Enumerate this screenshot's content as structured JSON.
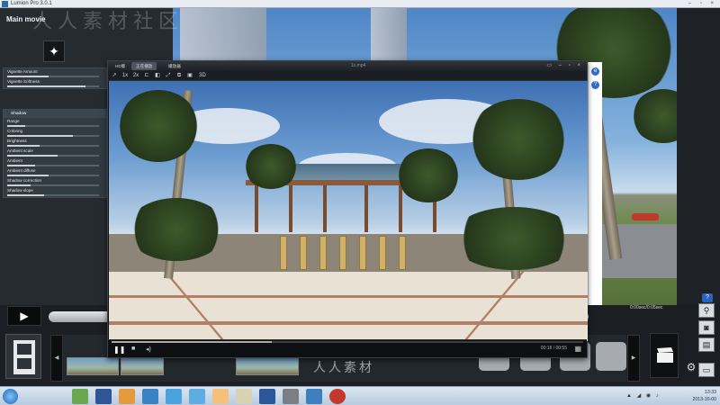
{
  "window": {
    "title": "Lumion Pro 3.0.1",
    "controls": "– ▫ ×"
  },
  "left_panel": {
    "title": "Main movie",
    "group1": [
      {
        "label": "Vignette Amount",
        "value": 0.45
      },
      {
        "label": "Vignette Softness",
        "value": 0.85
      }
    ],
    "shadow_header": "Shadow",
    "group2": [
      {
        "label": "Range",
        "value": 0.2
      },
      {
        "label": "Coloring",
        "value": 0.72
      },
      {
        "label": "Brightness",
        "value": 0.35
      },
      {
        "label": "Ambient scale",
        "value": 0.55
      },
      {
        "label": "Ambient",
        "value": 0.3
      },
      {
        "label": "Ambient diffuse",
        "value": 0.45
      },
      {
        "label": "Shadow correction",
        "value": 0.25
      },
      {
        "label": "Shadow slope",
        "value": 0.4
      }
    ]
  },
  "bottom": {
    "timecode": "0:00sec/0:05sec",
    "help": "?",
    "right_buttons": [
      "walk-icon",
      "camera-icon",
      "film-icon",
      "save-icon"
    ]
  },
  "player": {
    "tabs": [
      "HD版",
      "正在播放",
      "播放器"
    ],
    "file": "1x.mp4",
    "window_controls": "▭ – ▫ ×",
    "toolbar": [
      "↗",
      "1x",
      "2x",
      "⊏",
      "◧",
      "⤢",
      "⧉",
      "▣",
      "3D"
    ],
    "time": "00:18 / 00:55",
    "progress": 0.34,
    "play_glyph": "❚❚",
    "stop_glyph": "■",
    "volume_glyph": "◂)"
  },
  "taskbar": {
    "clock_time": "13:33",
    "clock_date": "2013-10-00"
  },
  "watermark": {
    "top": "人人素材社区",
    "bottom": "人人素材"
  }
}
